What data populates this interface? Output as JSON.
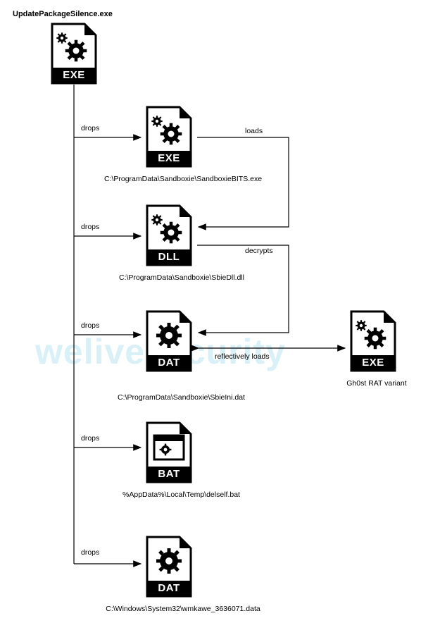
{
  "title": "UpdatePackageSilence.exe",
  "watermark": "welivesecurity",
  "nodes": {
    "root": {
      "band": "EXE",
      "caption": ""
    },
    "exe2": {
      "band": "EXE",
      "caption": "C:\\ProgramData\\Sandboxie\\SandboxieBITS.exe"
    },
    "dll": {
      "band": "DLL",
      "caption": "C:\\ProgramData\\Sandboxie\\SbieDll.dll"
    },
    "dat1": {
      "band": "DAT",
      "caption": "C:\\ProgramData\\Sandboxie\\SbieIni.dat"
    },
    "bat": {
      "band": "BAT",
      "caption": "%AppData%\\Local\\Temp\\delself.bat"
    },
    "dat2": {
      "band": "DAT",
      "caption": "C:\\Windows\\System32\\wmkawe_3636071.data"
    },
    "ghost": {
      "band": "EXE",
      "caption": "Gh0st RAT variant"
    }
  },
  "edges": {
    "drops1": "drops",
    "drops2": "drops",
    "drops3": "drops",
    "drops4": "drops",
    "drops5": "drops",
    "loads": "loads",
    "decrypts": "decrypts",
    "refl": "reflectively loads"
  }
}
